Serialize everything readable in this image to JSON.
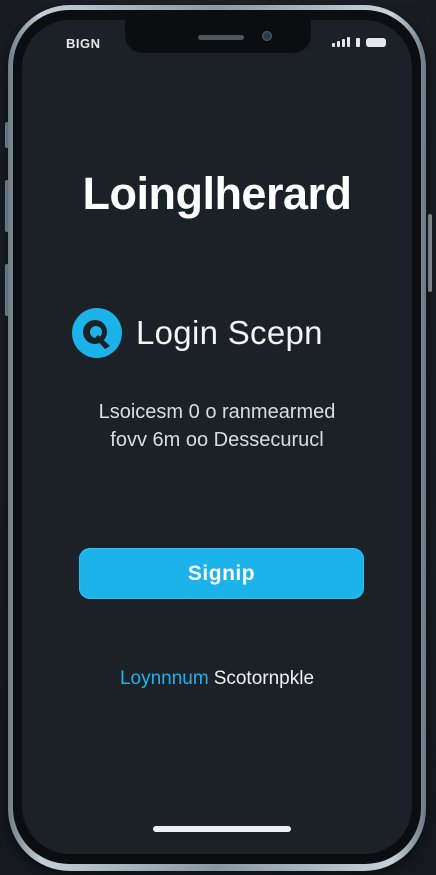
{
  "status_bar": {
    "time": "BIGN"
  },
  "app": {
    "title": "Loinglherard"
  },
  "header": {
    "screen_title": "Login Scepn",
    "logo_icon": "circle-logo-icon",
    "accent_color": "#1cb2ea"
  },
  "description": {
    "line1": "Lsoicesm 0 o ranmearmed",
    "line2": "fovv 6m oo Dessecurucl"
  },
  "actions": {
    "signup_label": "Signip"
  },
  "footer": {
    "link_part1": "Loynnnum",
    "link_part2": "Scotornpkle"
  }
}
